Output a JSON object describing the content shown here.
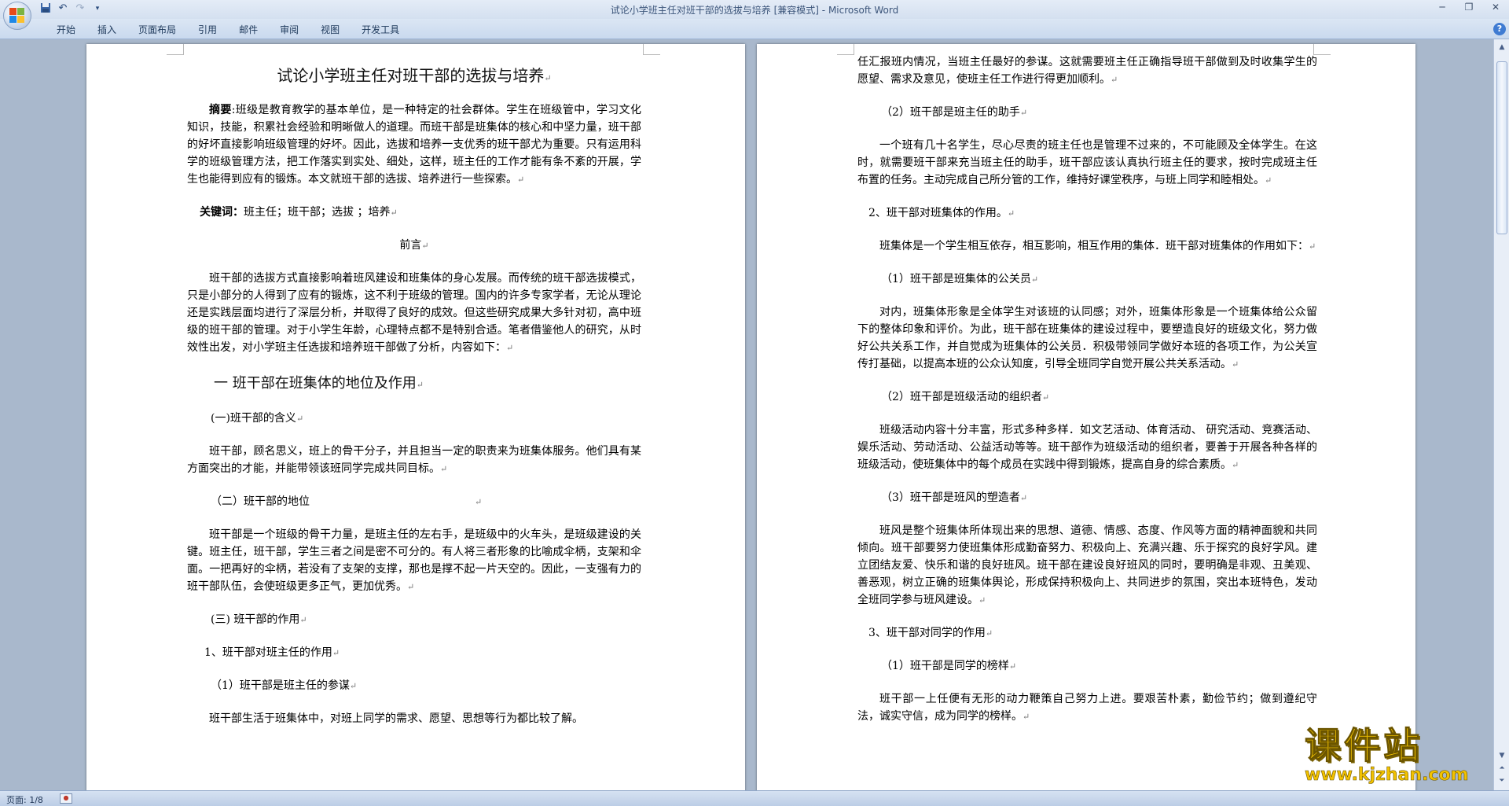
{
  "window": {
    "title": "试论小学班主任对班干部的选拔与培养 [兼容模式]",
    "app": "Microsoft Word",
    "title_separator": " - "
  },
  "quick_access": [
    "save-icon",
    "undo-icon",
    "redo-icon",
    "customize-icon"
  ],
  "ribbon": {
    "tabs": [
      "开始",
      "插入",
      "页面布局",
      "引用",
      "邮件",
      "审阅",
      "视图",
      "开发工具"
    ]
  },
  "page1": {
    "title": "试论小学班主任对班干部的选拔与培养",
    "abstract_label": "摘要",
    "abstract": ":班级是教育教学的基本单位，是一种特定的社会群体。学生在班级管中，学习文化知识，技能，积累社会经验和明晰做人的道理。而班干部是班集体的核心和中坚力量，班干部的好坏直接影响班级管理的好坏。因此，选拔和培养一支优秀的班干部尤为重要。只有运用科学的班级管理方法，把工作落实到实处、细处，这样，班主任的工作才能有条不紊的开展，学生也能得到应有的锻炼。本文就班干部的选拔、培养进行一些探索。",
    "keywords_label": "关键词：",
    "keywords": "班主任；班干部；选拔 ；培养",
    "preface_heading": "前言",
    "preface": "班干部的选拔方式直接影响着班风建设和班集体的身心发展。而传统的班干部选拔模式，只是小部分的人得到了应有的锻炼，这不利于班级的管理。国内的许多专家学者，无论从理论还是实践层面均进行了深层分析，并取得了良好的成效。但这些研究成果大多针对初，高中班级的班干部的管理。对于小学生年龄，心理特点都不是特别合适。笔者借鉴他人的研究，从时效性出发，对小学班主任选拔和培养班干部做了分析，内容如下：",
    "section1": "一  班干部在班集体的地位及作用",
    "sub1": "(一)班干部的含义",
    "sub1_text": "班干部，顾名思义，班上的骨干分子，并且担当一定的职责来为班集体服务。他们具有某方面突出的才能，并能带领该班同学完成共同目标。",
    "sub2": "（二）班干部的地位",
    "sub2_text": "班干部是一个班级的骨干力量，是班主任的左右手，是班级中的火车头，是班级建设的关键。班主任，班干部，学生三者之间是密不可分的。有人将三者形象的比喻成伞柄，支架和伞面。一把再好的伞柄，若没有了支架的支撑，那也是撑不起一片天空的。因此，一支强有力的班干部队伍，会使班级更多正气，更加优秀。",
    "sub3": "(三) 班干部的作用",
    "item1": "1、班干部对班主任的作用",
    "item1_1": "（1）班干部是班主任的参谋",
    "item1_1_text": "班干部生活于班集体中，对班上同学的需求、愿望、思想等行为都比较了解。"
  },
  "page2": {
    "cont_text": "任汇报班内情况，当班主任最好的参谋。这就需要班主任正确指导班干部做到及时收集学生的愿望、需求及意见，使班主任工作进行得更加顺利。",
    "item1_2": "（2）班干部是班主任的助手",
    "item1_2_text": "一个班有几十名学生，尽心尽责的班主任也是管理不过来的，不可能顾及全体学生。在这时，就需要班干部来充当班主任的助手，班干部应该认真执行班主任的要求，按时完成班主任布置的任务。主动完成自己所分管的工作，维持好课堂秩序，与班上同学和睦相处。",
    "item2": "2、班干部对班集体的作用。",
    "item2_text": "班集体是一个学生相互依存，相互影响，相互作用的集体．班干部对班集体的作用如下：",
    "item2_1": "（1）班干部是班集体的公关员",
    "item2_1_text": "对内，班集体形象是全体学生对该班的认同感；对外，班集体形象是一个班集体给公众留下的整体印象和评价。为此，班干部在班集体的建设过程中，要塑造良好的班级文化，努力做好公共关系工作，并自觉成为班集体的公关员．积极带领同学做好本班的各项工作，为公关宣传打基础，以提高本班的公众认知度，引导全班同学自觉开展公共关系活动。",
    "item2_2": "（2）班干部是班级活动的组织者",
    "item2_2_text": "班级活动内容十分丰富，形式多种多样．如文艺活动、体育活动、 研究活动、竞赛活动、娱乐活动、劳动活动、公益活动等等。班干部作为班级活动的组织者，要善于开展各种各样的班级活动，使班集体中的每个成员在实践中得到锻炼，提高自身的综合素质。",
    "item2_3": "（3）班干部是班风的塑造者",
    "item2_3_text": "班风是整个班集体所体现出来的思想、道德、情感、态度、作风等方面的精神面貌和共同倾向。班干部要努力使班集体形成勤奋努力、积极向上、充满兴趣、乐于探究的良好学风。建立团结友爱、快乐和谐的良好班风。班干部在建设良好班风的同时，要明确是非观、丑美观、善恶观，树立正确的班集体舆论，形成保持积极向上、共同进步的氛围，突出本班特色，发动全班同学参与班风建设。",
    "item3": "3、班干部对同学的作用",
    "item3_1": "（1）班干部是同学的榜样",
    "item3_1_text": "班干部一上任便有无形的动力鞭策自己努力上进。要艰苦朴素，勤俭节约；做到遵纪守法，诚实守信，成为同学的榜样。"
  },
  "status": {
    "page": "页面: 1/8"
  },
  "watermark": {
    "brand": "课件站",
    "url": "www.kjzhan.com"
  },
  "colors": {
    "workspace": "#a9b8cc",
    "ribbon": "#c9d9ee",
    "watermark": "#f2c200"
  }
}
